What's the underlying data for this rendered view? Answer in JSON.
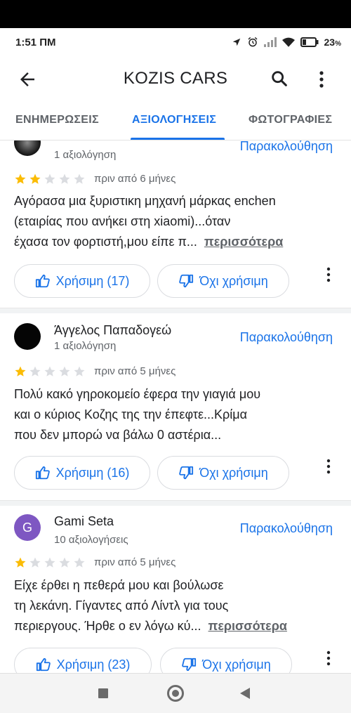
{
  "status_bar": {
    "time": "1:51 ΠΜ",
    "battery": "23"
  },
  "app_bar": {
    "title": "KOZIS CARS",
    "back_icon": "arrow-left-icon",
    "search_icon": "search-icon",
    "more_icon": "more-vert-icon"
  },
  "tabs": [
    {
      "label": "ΕΝΗΜΕΡΩΣΕΙΣ",
      "active": false
    },
    {
      "label": "ΑΞΙΟΛΟΓΗΣΕΙΣ",
      "active": true
    },
    {
      "label": "ΦΩΤΟΓΡΑΦΙΕΣ",
      "active": false
    }
  ],
  "reviews": [
    {
      "name": "",
      "count": "1 αξιολόγηση",
      "follow": "Παρακολούθηση",
      "rating": 2,
      "time": "πριν από 6 μήνες",
      "text_lines": [
        "Αγόρασα μια ξυριστικη μηχανή μάρκας enchen",
        "(εταιρίας που ανήκει στη xiaomi)...όταν",
        "έχασα τον φορτιστή,μου είπε π..."
      ],
      "more": "περισσότερα",
      "helpful": "Χρήσιμη (17)",
      "not_helpful": "Όχι χρήσιμη"
    },
    {
      "name": "Άγγελος Παπαδογεώ",
      "count": "1 αξιολόγηση",
      "follow": "Παρακολούθηση",
      "rating": 1,
      "time": "πριν από 5 μήνες",
      "text_lines": [
        "Πολύ κακό γηροκομείο έφερα την γιαγιά μου",
        "και ο κύριος Κοζης της την έπεφτε...Κρίμα",
        "που δεν μπορώ να βάλω 0 αστέρια..."
      ],
      "more": "",
      "helpful": "Χρήσιμη (16)",
      "not_helpful": "Όχι χρήσιμη"
    },
    {
      "name": "Gami Seta",
      "avatar_letter": "G",
      "count": "10 αξιολογήσεις",
      "follow": "Παρακολούθηση",
      "rating": 1,
      "time": "πριν από 5 μήνες",
      "text_lines": [
        "Είχε έρθει η πεθερά μου και βούλωσε",
        "τη λεκάνη. Γίγαντες από Λίντλ για τους",
        "περιεργους. Ήρθε ο εν λόγω κύ..."
      ],
      "more": "περισσότερα",
      "helpful": "Χρήσιμη (23)",
      "not_helpful": "Όχι χρήσιμη"
    }
  ],
  "colors": {
    "accent": "#1a73e8",
    "star_filled": "#fbbc04",
    "star_empty": "#dadce0",
    "text_secondary": "#5f6368"
  },
  "nav_bar": {
    "recents_icon": "square-icon",
    "home_icon": "circle-home-icon",
    "back_icon": "triangle-back-icon"
  }
}
